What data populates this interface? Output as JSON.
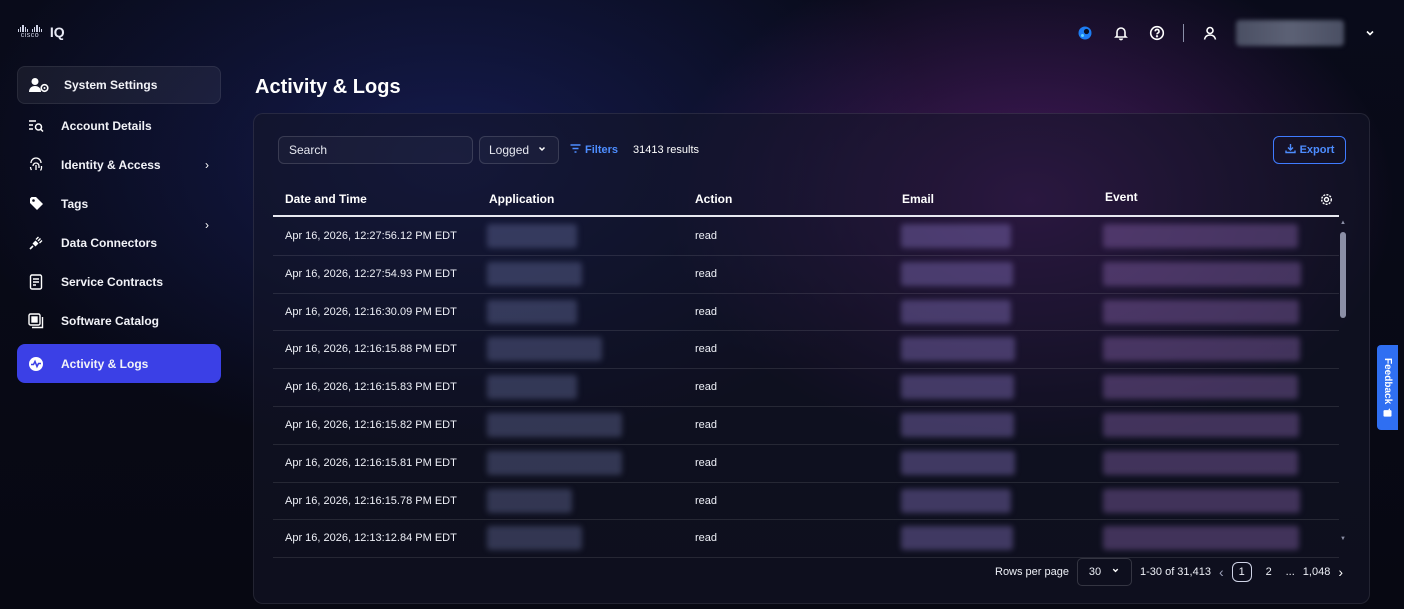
{
  "app": {
    "logo_word": "cisco",
    "product": "IQ"
  },
  "topbar": {
    "icons": [
      "webex-icon",
      "bell-icon",
      "help-icon",
      "user-icon",
      "chevron-down-icon"
    ]
  },
  "sidebar": {
    "header": {
      "label": "System Settings",
      "icon": "user-gear-icon"
    },
    "items": [
      {
        "label": "Account Details",
        "icon": "list-search-icon"
      },
      {
        "label": "Identity & Access",
        "icon": "fingerprint-icon",
        "has_children": true
      },
      {
        "label": "Tags",
        "icon": "tag-icon"
      },
      {
        "label": "Data Connectors",
        "icon": "plug-icon"
      },
      {
        "label": "Service Contracts",
        "icon": "contract-icon"
      },
      {
        "label": "Software Catalog",
        "icon": "catalog-icon"
      },
      {
        "label": "Activity & Logs",
        "icon": "activity-icon",
        "active": true
      }
    ]
  },
  "main": {
    "title": "Activity & Logs",
    "toolbar": {
      "search_placeholder": "Search",
      "filter_select": "Logged",
      "filters_label": "Filters",
      "results": "31413 results",
      "export_label": "Export"
    },
    "table": {
      "columns": [
        "Date and Time",
        "Application",
        "Action",
        "Email",
        "Event"
      ],
      "rows": [
        {
          "date": "Apr 16, 2026, 12:27:56.12 PM EDT",
          "action": "read"
        },
        {
          "date": "Apr 16, 2026, 12:27:54.93 PM EDT",
          "action": "read"
        },
        {
          "date": "Apr 16, 2026, 12:16:30.09 PM EDT",
          "action": "read"
        },
        {
          "date": "Apr 16, 2026, 12:16:15.88 PM EDT",
          "action": "read"
        },
        {
          "date": "Apr 16, 2026, 12:16:15.83 PM EDT",
          "action": "read"
        },
        {
          "date": "Apr 16, 2026, 12:16:15.82 PM EDT",
          "action": "read"
        },
        {
          "date": "Apr 16, 2026, 12:16:15.81 PM EDT",
          "action": "read"
        },
        {
          "date": "Apr 16, 2026, 12:16:15.78 PM EDT",
          "action": "read"
        },
        {
          "date": "Apr 16, 2026, 12:13:12.84 PM EDT",
          "action": "read"
        }
      ]
    },
    "pagination": {
      "rows_per_page_label": "Rows per page",
      "rows_per_page": "30",
      "range": "1-30 of 31,413",
      "current_page": "1",
      "next_page": "2",
      "ellipsis": "...",
      "last_page": "1,048"
    }
  },
  "feedback_label": "Feedback",
  "colors": {
    "accent": "#3b40e6",
    "link": "#4d8dff",
    "feedback": "#2f6ff2"
  }
}
